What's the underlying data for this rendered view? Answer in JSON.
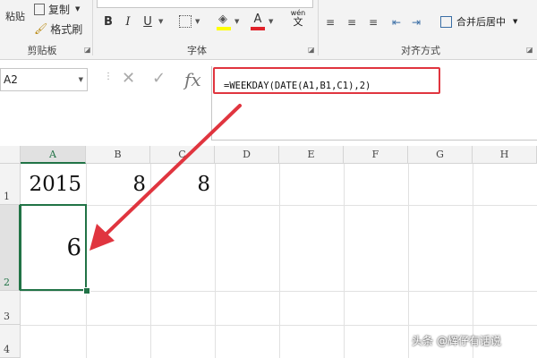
{
  "ribbon": {
    "clipboard": {
      "paste_label": "粘贴",
      "copy_label": "复制",
      "format_painter_label": "格式刷",
      "group_label": "剪贴板"
    },
    "font": {
      "bold": "B",
      "italic": "I",
      "underline": "U",
      "font_color_glyph": "A",
      "phonetic_top": "wén",
      "phonetic_bottom": "文",
      "group_label": "字体"
    },
    "alignment": {
      "merge_label": "合并后居中",
      "group_label": "对齐方式"
    }
  },
  "formula_bar": {
    "name_box": "A2",
    "cancel_glyph": "✕",
    "enter_glyph": "✓",
    "fx_label": "fx",
    "formula": "=WEEKDAY(DATE(A1,B1,C1),2)"
  },
  "sheet": {
    "columns": [
      "A",
      "B",
      "C",
      "D",
      "E",
      "F",
      "G",
      "H"
    ],
    "rows": [
      "1",
      "2",
      "3",
      "4"
    ],
    "cells": {
      "A1": "2015",
      "B1": "8",
      "C1": "8",
      "A2": "6"
    },
    "selected_cell": "A2"
  },
  "watermark": "头条 @辉仔有话说",
  "colors": {
    "accent_green": "#217346",
    "annotation_red": "#e0353f"
  }
}
